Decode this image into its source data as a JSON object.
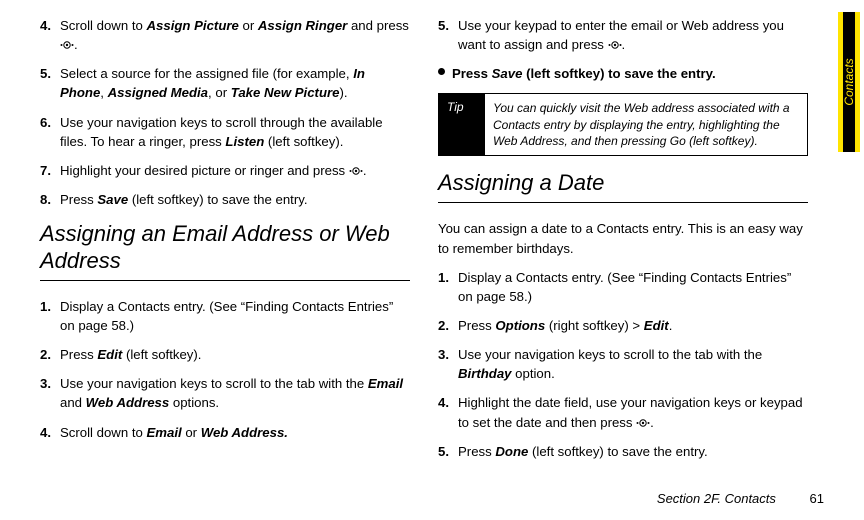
{
  "side_tab": "Contacts",
  "nav_icon_name": "navigation-key-icon",
  "left": {
    "steps_a": [
      {
        "n": "4.",
        "frags": [
          [
            "",
            "Scroll down to "
          ],
          [
            "bi",
            "Assign Picture"
          ],
          [
            "",
            " or "
          ],
          [
            "bi",
            "Assign Ringer"
          ],
          [
            "",
            " and press "
          ],
          [
            "icon",
            ""
          ],
          [
            "",
            "."
          ]
        ]
      },
      {
        "n": "5.",
        "frags": [
          [
            "",
            "Select a source for the assigned file (for example, "
          ],
          [
            "bi",
            "In Phone"
          ],
          [
            "",
            ", "
          ],
          [
            "bi",
            "Assigned Media"
          ],
          [
            "",
            ", or "
          ],
          [
            "bi",
            "Take New Picture"
          ],
          [
            "",
            ")."
          ]
        ]
      },
      {
        "n": "6.",
        "frags": [
          [
            "",
            "Use your navigation keys to scroll through the available files. To hear a ringer, press "
          ],
          [
            "bi",
            "Listen"
          ],
          [
            "",
            " (left softkey)."
          ]
        ]
      },
      {
        "n": "7.",
        "frags": [
          [
            "",
            "Highlight your desired picture or ringer and press "
          ],
          [
            "icon",
            ""
          ],
          [
            "",
            "."
          ]
        ]
      },
      {
        "n": "8.",
        "frags": [
          [
            "",
            "Press "
          ],
          [
            "bi",
            "Save"
          ],
          [
            "",
            " (left softkey) to save the entry."
          ]
        ]
      }
    ],
    "heading_a": "Assigning an Email Address or Web Address",
    "steps_b": [
      {
        "n": "1.",
        "frags": [
          [
            "",
            "Display a Contacts entry. (See “Finding Contacts Entries” on page 58.)"
          ]
        ]
      },
      {
        "n": "2.",
        "frags": [
          [
            "",
            "Press "
          ],
          [
            "bi",
            "Edit"
          ],
          [
            "",
            " (left softkey)."
          ]
        ]
      },
      {
        "n": "3.",
        "frags": [
          [
            "",
            "Use your navigation keys to scroll to the tab with the "
          ],
          [
            "bi",
            "Email"
          ],
          [
            "",
            " and "
          ],
          [
            "bi",
            "Web Address"
          ],
          [
            "",
            " options."
          ]
        ]
      },
      {
        "n": "4.",
        "frags": [
          [
            "",
            "Scroll down to "
          ],
          [
            "bi",
            "Email"
          ],
          [
            "",
            " or "
          ],
          [
            "bi",
            "Web Address."
          ]
        ]
      }
    ]
  },
  "right": {
    "steps_c": [
      {
        "n": "5.",
        "frags": [
          [
            "",
            "Use your keypad to enter the email or Web address you want to assign and press "
          ],
          [
            "icon",
            ""
          ],
          [
            "",
            "."
          ]
        ]
      }
    ],
    "bullet_line_frags": [
      [
        "",
        "Press "
      ],
      [
        "bi",
        "Save"
      ],
      [
        "",
        " (left softkey) to save the entry."
      ]
    ],
    "tip_label": "Tip",
    "tip_text": "You can quickly visit the Web address associated with a Contacts entry by displaying the entry, highlighting the Web Address, and then pressing Go (left softkey).",
    "heading_b": "Assigning a Date",
    "intro_b": "You can assign a date to a Contacts entry. This is an easy way to remember birthdays.",
    "steps_d": [
      {
        "n": "1.",
        "frags": [
          [
            "",
            "Display a Contacts entry. (See “Finding Contacts Entries” on page 58.)"
          ]
        ]
      },
      {
        "n": "2.",
        "frags": [
          [
            "",
            "Press "
          ],
          [
            "bi",
            "Options"
          ],
          [
            "",
            " (right softkey) > "
          ],
          [
            "bi",
            "Edit"
          ],
          [
            "",
            "."
          ]
        ]
      },
      {
        "n": "3.",
        "frags": [
          [
            "",
            "Use your navigation keys to scroll to the tab with the "
          ],
          [
            "bi",
            "Birthday"
          ],
          [
            "",
            " option."
          ]
        ]
      },
      {
        "n": "4.",
        "frags": [
          [
            "",
            "Highlight the date field, use your navigation keys or keypad to set the date and then press "
          ],
          [
            "icon",
            ""
          ],
          [
            "",
            "."
          ]
        ]
      },
      {
        "n": "5.",
        "frags": [
          [
            "",
            "Press "
          ],
          [
            "bi",
            "Done"
          ],
          [
            "",
            " (left softkey) to save the entry."
          ]
        ]
      }
    ]
  },
  "footer_section": "Section 2F. Contacts",
  "footer_page": "61"
}
